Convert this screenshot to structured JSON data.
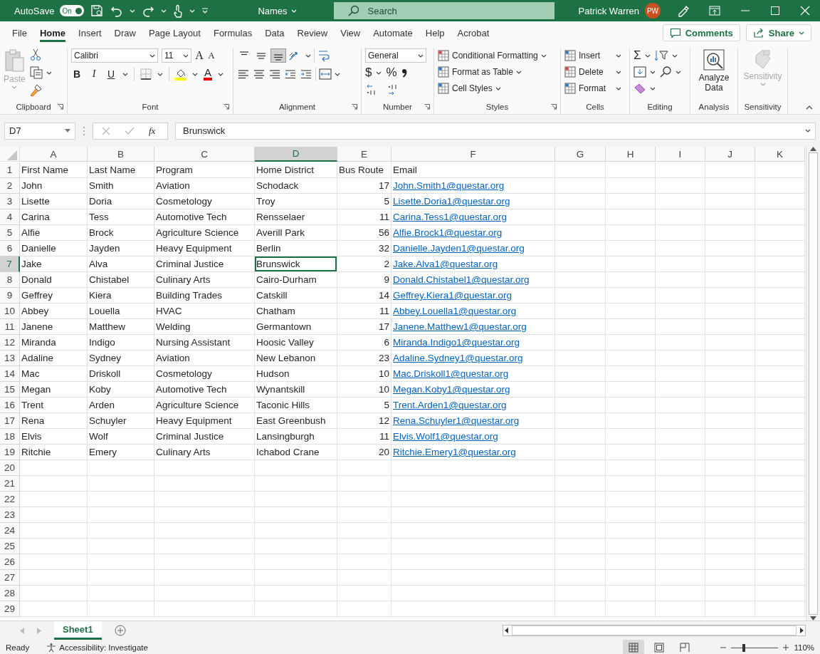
{
  "title_bar": {
    "autosave_label": "AutoSave",
    "autosave": {
      "label": "On",
      "on": true
    },
    "document_name": "Names",
    "search": {
      "placeholder": "Search"
    },
    "user_name": "Patrick Warren",
    "avatar_initials": "PW"
  },
  "menu_tabs": [
    {
      "label": "File",
      "selected": false
    },
    {
      "label": "Home",
      "selected": true
    },
    {
      "label": "Insert",
      "selected": false
    },
    {
      "label": "Draw",
      "selected": false
    },
    {
      "label": "Page Layout",
      "selected": false
    },
    {
      "label": "Formulas",
      "selected": false
    },
    {
      "label": "Data",
      "selected": false
    },
    {
      "label": "Review",
      "selected": false
    },
    {
      "label": "View",
      "selected": false
    },
    {
      "label": "Automate",
      "selected": false
    },
    {
      "label": "Help",
      "selected": false
    },
    {
      "label": "Acrobat",
      "selected": false
    }
  ],
  "comments_button": "Comments",
  "share_button": "Share",
  "ribbon": {
    "clipboard": {
      "label": "Clipboard",
      "paste": {
        "label": "Paste",
        "disabled": true
      }
    },
    "font": {
      "label": "Font",
      "font_name": "Calibri",
      "font_size": "11",
      "grow_font": "A",
      "shrink_font": "A",
      "bold": "B",
      "italic": "I",
      "underline": "U",
      "font_color": "A"
    },
    "alignment": {
      "label": "Alignment",
      "vertical_align_buttons": [
        {
          "selected": false
        },
        {
          "selected": false
        },
        {
          "selected": true
        }
      ]
    },
    "number": {
      "label": "Number",
      "format": "General",
      "currency": "$",
      "percent": "%"
    },
    "styles": {
      "label": "Styles",
      "items": [
        "Conditional Formatting",
        "Format as Table",
        "Cell Styles"
      ]
    },
    "cells": {
      "label": "Cells",
      "items": [
        "Insert",
        "Delete",
        "Format"
      ]
    },
    "editing": {
      "label": "Editing",
      "autosum": "Σ"
    },
    "analysis": {
      "label": "Analysis",
      "analyze_data": "Analyze Data"
    },
    "sensitivity": {
      "label": "Sensitivity",
      "button": {
        "label": "Sensitivity",
        "disabled": true
      }
    }
  },
  "formula_bar": {
    "name_box": "D7",
    "function_label": "fx",
    "value": "Brunswick"
  },
  "sheet": {
    "columns": [
      {
        "label": "A",
        "kind": "text",
        "selected": false
      },
      {
        "label": "B",
        "kind": "text",
        "selected": false
      },
      {
        "label": "C",
        "kind": "text",
        "selected": false
      },
      {
        "label": "D",
        "kind": "text",
        "selected": true
      },
      {
        "label": "E",
        "kind": "number",
        "selected": false
      },
      {
        "label": "F",
        "kind": "link",
        "selected": false
      },
      {
        "label": "G",
        "selected": false
      },
      {
        "label": "H",
        "selected": false
      },
      {
        "label": "I",
        "selected": false
      },
      {
        "label": "J",
        "selected": false
      },
      {
        "label": "K",
        "selected": false
      }
    ],
    "rows": [
      {
        "number": "1",
        "kind": "header",
        "selected": false,
        "cells": [
          "First Name",
          "Last Name",
          "Program",
          "Home District",
          "Bus Route",
          "Email"
        ]
      },
      {
        "number": "2",
        "kind": "data",
        "selected": false,
        "cells": [
          "John",
          "Smith",
          "Aviation",
          "Schodack",
          "17",
          "John.Smith1@questar.org"
        ]
      },
      {
        "number": "3",
        "kind": "data",
        "selected": false,
        "cells": [
          "Lisette",
          "Doria",
          "Cosmetology",
          "Troy",
          "5",
          "Lisette.Doria1@questar.org"
        ]
      },
      {
        "number": "4",
        "kind": "data",
        "selected": false,
        "cells": [
          "Carina",
          "Tess",
          "Automotive Tech",
          "Rensselaer",
          "11",
          "Carina.Tess1@questar.org"
        ]
      },
      {
        "number": "5",
        "kind": "data",
        "selected": false,
        "cells": [
          "Alfie",
          "Brock",
          "Agriculture Science",
          "Averill Park",
          "56",
          "Alfie.Brock1@questar.org"
        ]
      },
      {
        "number": "6",
        "kind": "data",
        "selected": false,
        "cells": [
          "Danielle",
          "Jayden",
          "Heavy Equipment",
          "Berlin",
          "32",
          "Danielle.Jayden1@questar.org"
        ]
      },
      {
        "number": "7",
        "kind": "data",
        "selected": true,
        "cells": [
          "Jake",
          "Alva",
          "Criminal Justice",
          "Brunswick",
          "2",
          "Jake.Alva1@questar.org"
        ]
      },
      {
        "number": "8",
        "kind": "data",
        "selected": false,
        "cells": [
          "Donald",
          "Chistabel",
          "Culinary Arts",
          "Cairo-Durham",
          "9",
          "Donald.Chistabel1@questar.org"
        ]
      },
      {
        "number": "9",
        "kind": "data",
        "selected": false,
        "cells": [
          "Geffrey",
          "Kiera",
          "Building Trades",
          "Catskill",
          "14",
          "Geffrey.Kiera1@questar.org"
        ]
      },
      {
        "number": "10",
        "kind": "data",
        "selected": false,
        "cells": [
          "Abbey",
          "Louella",
          "HVAC",
          "Chatham",
          "11",
          "Abbey.Louella1@questar.org"
        ]
      },
      {
        "number": "11",
        "kind": "data",
        "selected": false,
        "cells": [
          "Janene",
          "Matthew",
          "Welding",
          "Germantown",
          "17",
          "Janene.Matthew1@questar.org"
        ]
      },
      {
        "number": "12",
        "kind": "data",
        "selected": false,
        "cells": [
          "Miranda",
          "Indigo",
          "Nursing Assistant",
          "Hoosic Valley",
          "6",
          "Miranda.Indigo1@questar.org"
        ]
      },
      {
        "number": "13",
        "kind": "data",
        "selected": false,
        "cells": [
          "Adaline",
          "Sydney",
          "Aviation",
          "New Lebanon",
          "23",
          "Adaline.Sydney1@questar.org"
        ]
      },
      {
        "number": "14",
        "kind": "data",
        "selected": false,
        "cells": [
          "Mac",
          "Driskoll",
          "Cosmetology",
          "Hudson",
          "10",
          "Mac.Driskoll1@questar.org"
        ]
      },
      {
        "number": "15",
        "kind": "data",
        "selected": false,
        "cells": [
          "Megan",
          "Koby",
          "Automotive Tech",
          "Wynantskill",
          "10",
          "Megan.Koby1@questar.org"
        ]
      },
      {
        "number": "16",
        "kind": "data",
        "selected": false,
        "cells": [
          "Trent",
          "Arden",
          "Agriculture Science",
          "Taconic Hills",
          "5",
          "Trent.Arden1@questar.org"
        ]
      },
      {
        "number": "17",
        "kind": "data",
        "selected": false,
        "cells": [
          "Rena",
          "Schuyler",
          "Heavy Equipment",
          "East Greenbush",
          "12",
          "Rena.Schuyler1@questar.org"
        ]
      },
      {
        "number": "18",
        "kind": "data",
        "selected": false,
        "cells": [
          "Elvis",
          "Wolf",
          "Criminal Justice",
          "Lansingburgh",
          "11",
          "Elvis.Wolf1@questar.org"
        ]
      },
      {
        "number": "19",
        "kind": "data",
        "selected": false,
        "cells": [
          "Ritchie",
          "Emery",
          "Culinary Arts",
          "Ichabod Crane",
          "20",
          "Ritchie.Emery1@questar.org"
        ]
      },
      {
        "number": "20",
        "selected": false
      },
      {
        "number": "21",
        "selected": false
      },
      {
        "number": "22",
        "selected": false
      },
      {
        "number": "23",
        "selected": false
      },
      {
        "number": "24",
        "selected": false
      },
      {
        "number": "25",
        "selected": false
      },
      {
        "number": "26",
        "selected": false
      },
      {
        "number": "27",
        "selected": false
      },
      {
        "number": "28",
        "selected": false
      },
      {
        "number": "29",
        "selected": false
      }
    ]
  },
  "sheet_tabs": [
    {
      "label": "Sheet1",
      "selected": true
    }
  ],
  "status_bar": {
    "status": "Ready",
    "accessibility": "Accessibility: Investigate",
    "views": [
      {
        "kind": "normal",
        "selected": true
      },
      {
        "kind": "page_layout",
        "selected": false
      },
      {
        "kind": "page_break",
        "selected": false
      }
    ],
    "zoom": {
      "level": 0.27,
      "reading": "110%"
    }
  }
}
